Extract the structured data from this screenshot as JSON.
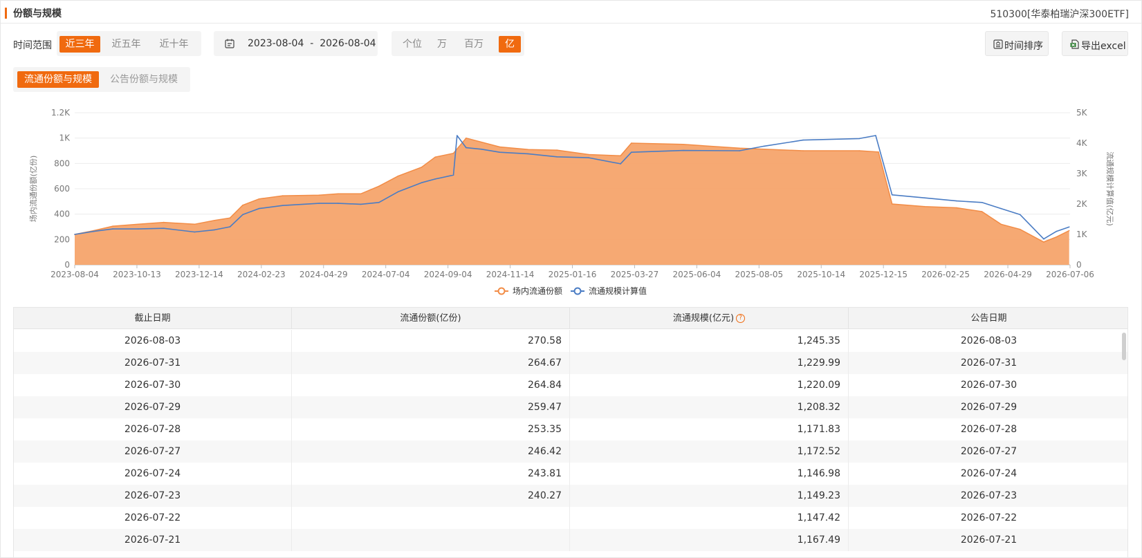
{
  "header": {
    "title": "份额与规模",
    "fund": "510300[华泰柏瑞沪深300ETF]"
  },
  "toolbar": {
    "time_label": "时间范围",
    "periods": [
      "近三年",
      "近五年",
      "近十年"
    ],
    "period_selected": "近三年",
    "date_range": "2023-08-04  -  2026-08-04",
    "units": [
      "个位",
      "万",
      "百万",
      "亿"
    ],
    "unit_selected": "亿",
    "sort_label": "时间排序",
    "export_label": "导出excel"
  },
  "subtabs": {
    "items": [
      "流通份额与规模",
      "公告份额与规模"
    ],
    "selected": "流通份额与规模"
  },
  "colors": {
    "accent": "#f06a0f",
    "area_fill": "#f6a46c",
    "area_line": "#f28c46",
    "line": "#4a7cc4"
  },
  "chart_data": {
    "type": "area",
    "x_ticks": [
      "2023-08-04",
      "2023-10-13",
      "2023-12-14",
      "2024-02-23",
      "2024-04-29",
      "2024-07-04",
      "2024-09-04",
      "2024-11-14",
      "2025-01-16",
      "2025-03-27",
      "2025-06-04",
      "2025-08-05",
      "2025-10-14",
      "2025-12-15",
      "2026-02-25",
      "2026-04-29",
      "2026-07-06"
    ],
    "y_left": {
      "label": "场内流通份额(亿份)",
      "ticks": [
        "0",
        "200",
        "400",
        "600",
        "800",
        "1K",
        "1.2K"
      ],
      "ylim": [
        0,
        1200
      ]
    },
    "y_right": {
      "label": "流通规模计算值(亿元)",
      "ticks": [
        "0",
        "1K",
        "2K",
        "3K",
        "4K",
        "5K"
      ],
      "ylim": [
        0,
        5000
      ]
    },
    "grid": true,
    "legend_position": "bottom",
    "series": [
      {
        "name": "场内流通份额",
        "axis": "left",
        "type": "area",
        "x": [
          "2023-08-04",
          "2023-08-25",
          "2023-09-15",
          "2023-10-13",
          "2023-11-10",
          "2023-12-14",
          "2024-01-05",
          "2024-01-22",
          "2024-02-05",
          "2024-02-23",
          "2024-03-20",
          "2024-04-29",
          "2024-05-20",
          "2024-06-14",
          "2024-07-04",
          "2024-07-25",
          "2024-08-20",
          "2024-09-04",
          "2024-09-24",
          "2024-10-08",
          "2024-11-14",
          "2024-12-15",
          "2025-01-16",
          "2025-02-20",
          "2025-03-27",
          "2025-04-08",
          "2025-06-04",
          "2025-08-05",
          "2025-10-14",
          "2025-12-15",
          "2026-01-05",
          "2026-01-20",
          "2026-02-25",
          "2026-04-01",
          "2026-04-29",
          "2026-05-20",
          "2026-06-10",
          "2026-07-06",
          "2026-07-20",
          "2026-08-03"
        ],
        "values": [
          240,
          270,
          305,
          320,
          335,
          320,
          350,
          370,
          470,
          520,
          545,
          550,
          560,
          560,
          620,
          700,
          770,
          850,
          880,
          1000,
          930,
          910,
          905,
          870,
          860,
          960,
          950,
          920,
          900,
          900,
          890,
          480,
          460,
          450,
          420,
          320,
          280,
          180,
          220,
          270
        ]
      },
      {
        "name": "流通规模计算值",
        "axis": "right",
        "type": "line",
        "x": [
          "2023-08-04",
          "2023-08-25",
          "2023-09-15",
          "2023-10-13",
          "2023-11-10",
          "2023-12-14",
          "2024-01-05",
          "2024-01-22",
          "2024-02-05",
          "2024-02-23",
          "2024-03-20",
          "2024-04-29",
          "2024-05-20",
          "2024-06-14",
          "2024-07-04",
          "2024-07-25",
          "2024-08-20",
          "2024-09-04",
          "2024-09-24",
          "2024-09-28",
          "2024-10-08",
          "2024-10-25",
          "2024-11-14",
          "2024-12-15",
          "2025-01-16",
          "2025-02-20",
          "2025-03-27",
          "2025-04-08",
          "2025-06-04",
          "2025-08-05",
          "2025-09-01",
          "2025-10-14",
          "2025-12-15",
          "2026-01-02",
          "2026-01-20",
          "2026-02-25",
          "2026-04-01",
          "2026-04-29",
          "2026-05-20",
          "2026-06-10",
          "2026-07-06",
          "2026-07-20",
          "2026-08-03"
        ],
        "values": [
          1000,
          1100,
          1180,
          1180,
          1200,
          1080,
          1150,
          1250,
          1650,
          1850,
          1950,
          2020,
          2020,
          1990,
          2050,
          2400,
          2700,
          2820,
          2950,
          4250,
          3850,
          3800,
          3700,
          3650,
          3550,
          3520,
          3320,
          3700,
          3760,
          3750,
          3900,
          4100,
          4150,
          4250,
          2300,
          2200,
          2100,
          2050,
          1850,
          1650,
          850,
          1100,
          1245
        ]
      }
    ]
  },
  "table": {
    "columns": [
      "截止日期",
      "流通份额(亿份)",
      "流通规模(亿元)",
      "公告日期"
    ],
    "rows": [
      [
        "2026-08-03",
        "270.58",
        "1,245.35",
        "2026-08-03"
      ],
      [
        "2026-07-31",
        "264.67",
        "1,229.99",
        "2026-07-31"
      ],
      [
        "2026-07-30",
        "264.84",
        "1,220.09",
        "2026-07-30"
      ],
      [
        "2026-07-29",
        "259.47",
        "1,208.32",
        "2026-07-29"
      ],
      [
        "2026-07-28",
        "253.35",
        "1,171.83",
        "2026-07-28"
      ],
      [
        "2026-07-27",
        "246.42",
        "1,172.52",
        "2026-07-27"
      ],
      [
        "2026-07-24",
        "243.81",
        "1,146.98",
        "2026-07-24"
      ],
      [
        "2026-07-23",
        "240.27",
        "1,149.23",
        "2026-07-23"
      ],
      [
        "2026-07-22",
        "",
        "1,147.42",
        "2026-07-22"
      ],
      [
        "2026-07-21",
        "",
        "1,167.49",
        "2026-07-21"
      ]
    ]
  }
}
